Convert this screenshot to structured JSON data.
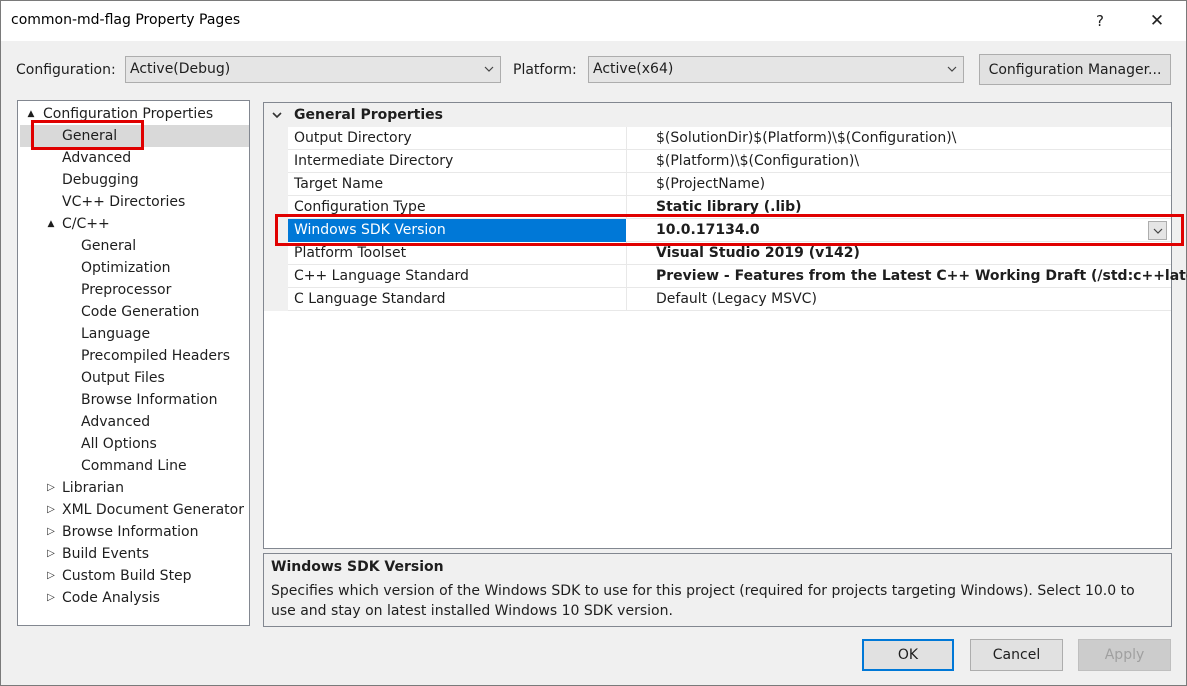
{
  "window": {
    "title": "common-md-flag Property Pages",
    "help_glyph": "?",
    "close_glyph": "✕"
  },
  "toolbar": {
    "configuration_label": "Configuration:",
    "configuration_value": "Active(Debug)",
    "platform_label": "Platform:",
    "platform_value": "Active(x64)",
    "config_manager_label": "Configuration Manager..."
  },
  "tree": {
    "items": [
      {
        "label": "Configuration Properties",
        "expander": "▲"
      },
      {
        "label": "General"
      },
      {
        "label": "Advanced"
      },
      {
        "label": "Debugging"
      },
      {
        "label": "VC++ Directories"
      },
      {
        "label": "C/C++",
        "expander": "▲"
      },
      {
        "label": "General"
      },
      {
        "label": "Optimization"
      },
      {
        "label": "Preprocessor"
      },
      {
        "label": "Code Generation"
      },
      {
        "label": "Language"
      },
      {
        "label": "Precompiled Headers"
      },
      {
        "label": "Output Files"
      },
      {
        "label": "Browse Information"
      },
      {
        "label": "Advanced"
      },
      {
        "label": "All Options"
      },
      {
        "label": "Command Line"
      },
      {
        "label": "Librarian",
        "expander": "▷"
      },
      {
        "label": "XML Document Generator",
        "expander": "▷"
      },
      {
        "label": "Browse Information",
        "expander": "▷"
      },
      {
        "label": "Build Events",
        "expander": "▷"
      },
      {
        "label": "Custom Build Step",
        "expander": "▷"
      },
      {
        "label": "Code Analysis",
        "expander": "▷"
      }
    ]
  },
  "grid": {
    "section_title": "General Properties",
    "section_glyph": "⌄",
    "rows": [
      {
        "name": "Output Directory",
        "value": "$(SolutionDir)$(Platform)\\$(Configuration)\\"
      },
      {
        "name": "Intermediate Directory",
        "value": "$(Platform)\\$(Configuration)\\"
      },
      {
        "name": "Target Name",
        "value": "$(ProjectName)"
      },
      {
        "name": "Configuration Type",
        "value": "Static library (.lib)"
      },
      {
        "name": "Windows SDK Version",
        "value": "10.0.17134.0"
      },
      {
        "name": "Platform Toolset",
        "value": "Visual Studio 2019 (v142)"
      },
      {
        "name": "C++ Language Standard",
        "value": "Preview - Features from the Latest C++ Working Draft (/std:c++latest)"
      },
      {
        "name": "C Language Standard",
        "value": "Default (Legacy MSVC)"
      }
    ]
  },
  "description": {
    "title": "Windows SDK Version",
    "text": "Specifies which version of the Windows SDK to use for this project (required for projects targeting Windows). Select 10.0 to use and stay on latest installed Windows 10 SDK version."
  },
  "footer": {
    "ok_label": "OK",
    "cancel_label": "Cancel",
    "apply_label": "Apply"
  },
  "colors": {
    "selection": "#0078d7",
    "highlight_box": "#e00000"
  }
}
